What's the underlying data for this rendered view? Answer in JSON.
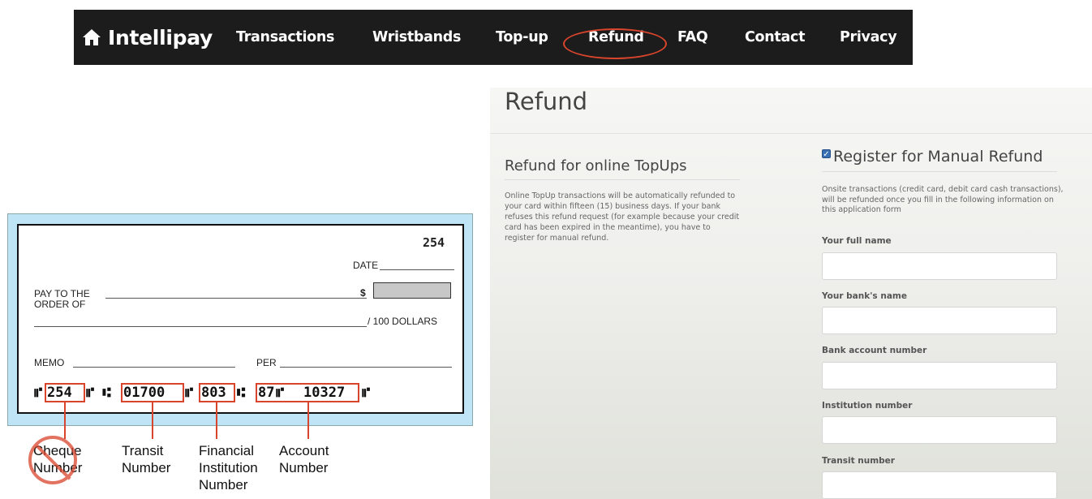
{
  "navbar": {
    "brand_icon": "home-icon",
    "brand": "Intellipay",
    "items": [
      "Transactions",
      "Wristbands",
      "Top-up",
      "Refund",
      "FAQ",
      "Contact",
      "Privacy"
    ],
    "highlight_color": "#d9452c"
  },
  "cheque": {
    "number": "254",
    "date_label": "DATE",
    "pay_to_line1": "PAY TO THE",
    "pay_to_line2": "ORDER OF",
    "dollar_sign": "$",
    "dollars_label": "/ 100 DOLLARS",
    "memo_label": "MEMO",
    "per_label": "PER",
    "micr": {
      "cheque_no": "254",
      "transit": "01700",
      "institution": "803",
      "account_a": "87",
      "account_b": "10327"
    },
    "callouts": {
      "cheque_1": "Cheque",
      "cheque_2": "Number",
      "transit_1": "Transit",
      "transit_2": "Number",
      "fin_1": "Financial",
      "fin_2": "Institution",
      "fin_3": "Number",
      "acct_1": "Account",
      "acct_2": "Number"
    }
  },
  "refund": {
    "title": "Refund",
    "online": {
      "heading": "Refund for online TopUps",
      "text": "Online TopUp transactions will be automatically refunded to your card within fifteen (15) business days. If your bank refuses this refund request (for example because your credit card has been expired in the meantime), you have to register for manual refund."
    },
    "manual": {
      "heading": "Register for Manual Refund",
      "checked": true,
      "text": "Onsite transactions (credit card, debit card cash transactions), will be refunded once you fill in the following information on this application form"
    },
    "fields": [
      {
        "label": "Your full name",
        "value": ""
      },
      {
        "label": "Your bank's name",
        "value": ""
      },
      {
        "label": "Bank account number",
        "value": ""
      },
      {
        "label": "Institution number",
        "value": ""
      },
      {
        "label": "Transit number",
        "value": ""
      }
    ]
  }
}
